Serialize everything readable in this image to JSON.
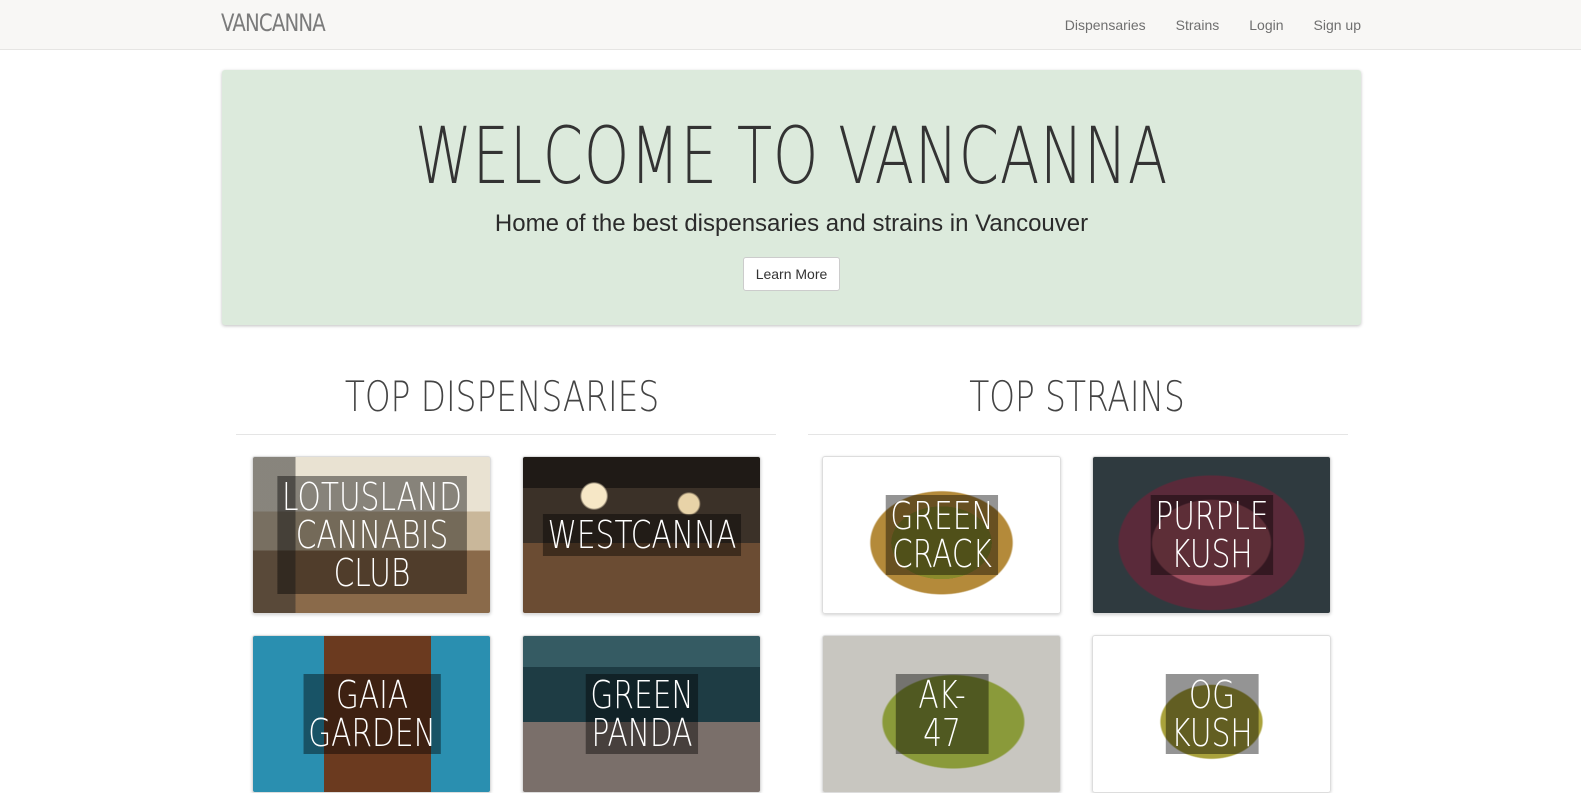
{
  "nav": {
    "brand": "VANCANNA",
    "links": [
      "Dispensaries",
      "Strains",
      "Login",
      "Sign up"
    ]
  },
  "jumbotron": {
    "title": "WELCOME TO VANCANNA",
    "subtitle": "Home of the best dispensaries and strains in Vancouver",
    "button": "Learn More"
  },
  "dispensaries": {
    "heading": "TOP DISPENSARIES",
    "items": [
      {
        "name": "LOTUSLAND\nCANNABIS\nCLUB"
      },
      {
        "name": "WESTCANNA"
      },
      {
        "name": "GAIA\nGARDEN"
      },
      {
        "name": "GREEN\nPANDA"
      }
    ]
  },
  "strains": {
    "heading": "TOP STRAINS",
    "items": [
      {
        "name": "GREEN\nCRACK"
      },
      {
        "name": "PURPLE\nKUSH"
      },
      {
        "name": "AK-47"
      },
      {
        "name": "OG KUSH"
      }
    ]
  },
  "colors": {
    "jumbotron_bg": "#dceadc",
    "navbar_bg": "#f8f7f5"
  }
}
